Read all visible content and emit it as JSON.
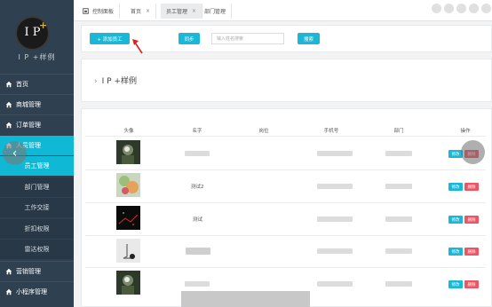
{
  "logo": {
    "text": "I P",
    "plus": "+",
    "subtitle": "I P +样例"
  },
  "sidebar": {
    "items": [
      {
        "label": "首页"
      },
      {
        "label": "商城管理"
      },
      {
        "label": "订单管理"
      },
      {
        "label": "人员管理"
      },
      {
        "label": "员工管理"
      },
      {
        "label": "部门管理"
      },
      {
        "label": "工作交接"
      },
      {
        "label": "折扣权限"
      },
      {
        "label": "雷达权限"
      },
      {
        "label": "营销管理"
      },
      {
        "label": "小程序管理"
      }
    ],
    "collapse_icon": "‹"
  },
  "tabs": [
    {
      "label": "控制面板"
    },
    {
      "label": "首页"
    },
    {
      "label": "员工管理"
    },
    {
      "label": "部门管理"
    }
  ],
  "tab_close": "×",
  "toolbar": {
    "add_label": "+ 添加员工",
    "sync_label": "同步",
    "search_placeholder": "输入姓名搜索",
    "search_label": "搜索"
  },
  "section": {
    "title": "I P +样例"
  },
  "table": {
    "headers": [
      "头像",
      "名字",
      "岗位",
      "手机号",
      "部门",
      "操作"
    ],
    "rows": [
      {
        "name": ""
      },
      {
        "name": "测试2"
      },
      {
        "name": "测试"
      },
      {
        "name": ""
      },
      {
        "name": ""
      }
    ],
    "edit_label": "修改",
    "delete_label": "删除"
  },
  "colors": {
    "accent": "#1ab7d6",
    "danger": "#ed5565",
    "sidebar": "#2f4050"
  }
}
